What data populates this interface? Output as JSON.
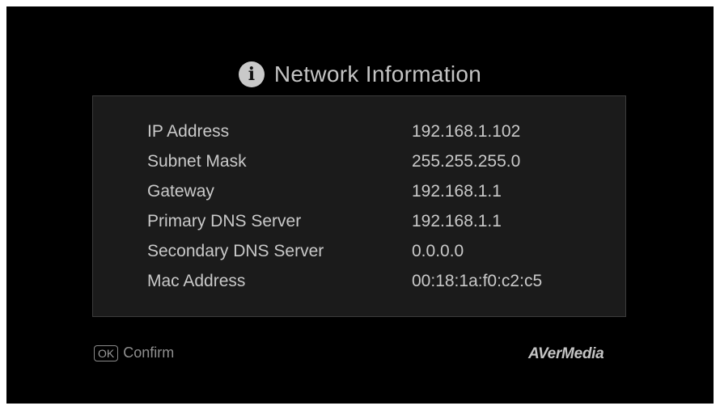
{
  "dialog": {
    "title_icon": "info-icon",
    "title_icon_glyph": "i",
    "title": "Network Information"
  },
  "network_info": {
    "rows": [
      {
        "label": "IP Address",
        "value": "192.168.1.102"
      },
      {
        "label": "Subnet Mask",
        "value": "255.255.255.0"
      },
      {
        "label": "Gateway",
        "value": "192.168.1.1"
      },
      {
        "label": "Primary DNS Server",
        "value": "192.168.1.1"
      },
      {
        "label": "Secondary DNS Server",
        "value": "0.0.0.0"
      },
      {
        "label": "Mac Address",
        "value": "00:18:1a:f0:c2:c5"
      }
    ]
  },
  "footer": {
    "ok_key": "OK",
    "ok_label": "Confirm",
    "brand": "AVerMedia"
  },
  "colors": {
    "background": "#000000",
    "panel": "#1b1b1b",
    "text": "#c9c9c9"
  }
}
